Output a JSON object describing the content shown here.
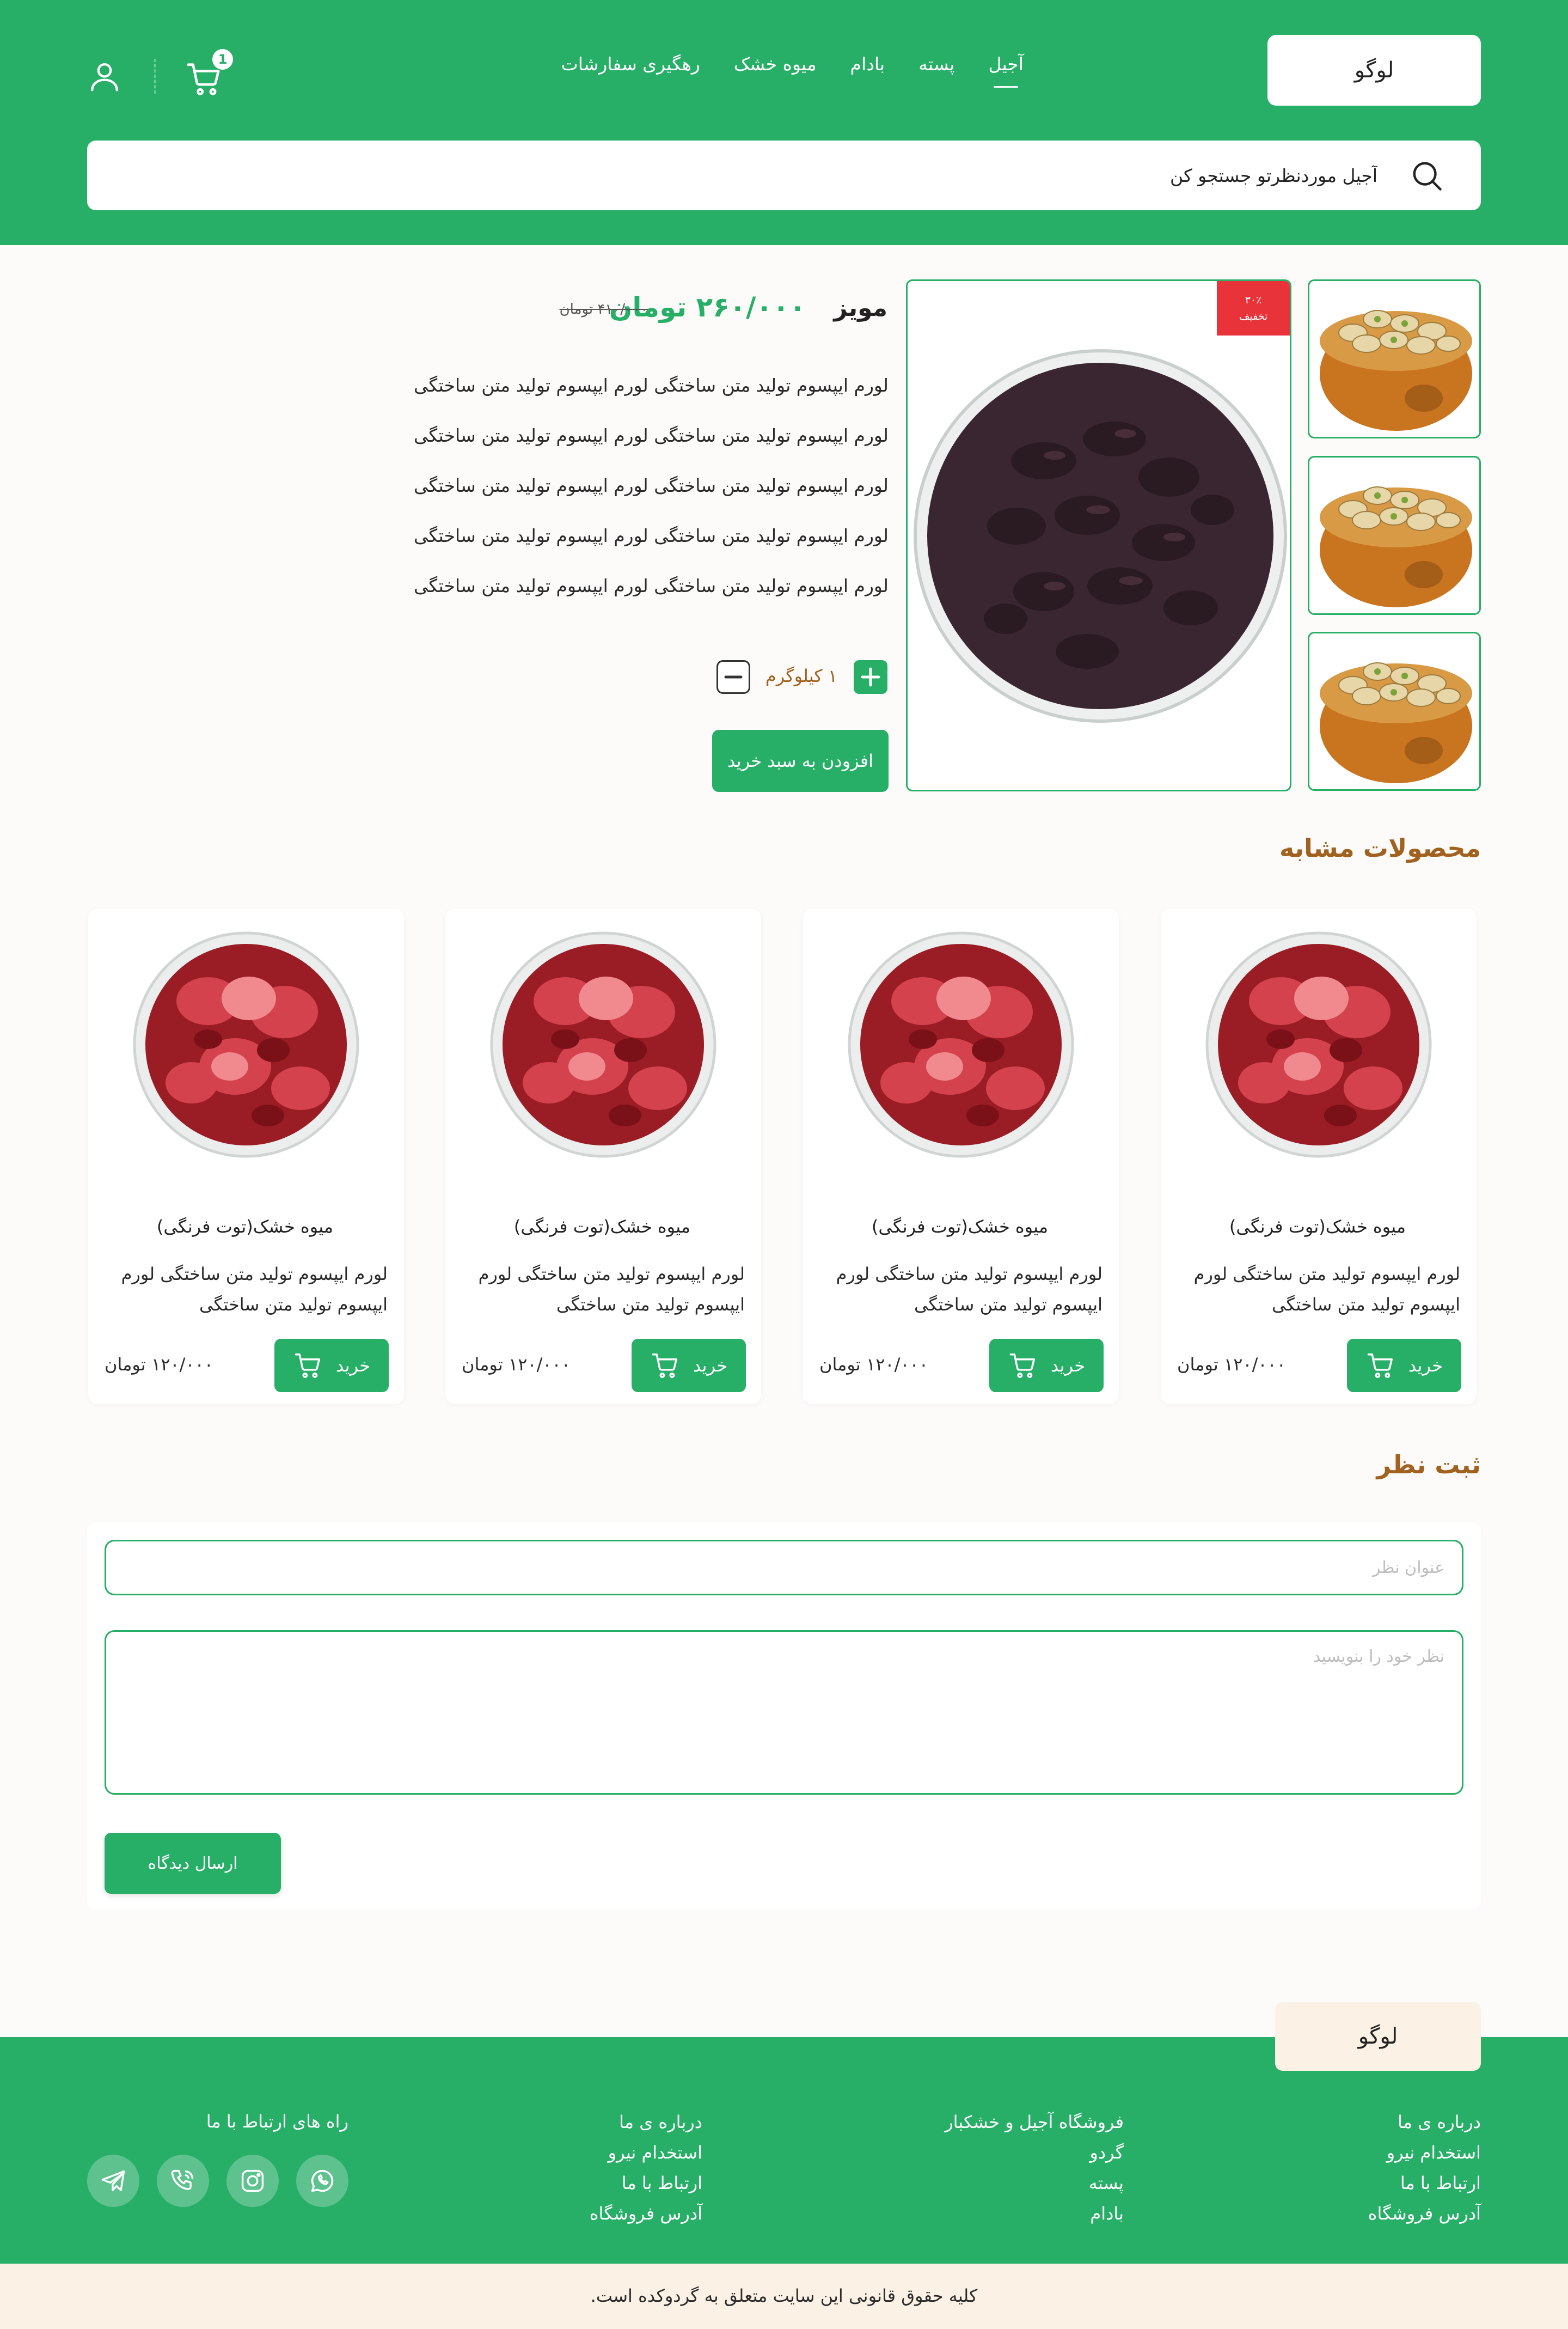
{
  "header": {
    "logo": "لوگو",
    "nav": [
      "آجیل",
      "پسته",
      "بادام",
      "میوه خشک",
      "رهگیری سفارشات"
    ],
    "active_nav": "آجیل",
    "cart_count": "1",
    "search_placeholder": "آجیل موردنظرتو جستجو کن"
  },
  "product": {
    "name": "مویز",
    "price": "۲۶۰/۰۰۰ تومان",
    "old_price": "۴۱۰/۰۰۰ تومان",
    "discount_percent": "۳۰٪",
    "discount_label": "تخفیف",
    "description_lines": [
      "لورم ایپسوم تولید متن ساختگی لورم ایپسوم تولید متن ساختگی",
      "لورم ایپسوم تولید متن ساختگی لورم ایپسوم تولید متن ساختگی",
      "لورم ایپسوم تولید متن ساختگی لورم ایپسوم تولید متن ساختگی",
      "لورم ایپسوم تولید متن ساختگی لورم ایپسوم تولید متن ساختگی",
      "لورم ایپسوم تولید متن ساختگی لورم ایپسوم تولید متن ساختگی"
    ],
    "quantity": "۱ کیلوگرم",
    "add_to_cart": "افزودن به سبد خرید"
  },
  "similar": {
    "title": "محصولات مشابه",
    "products": [
      {
        "name": "میوه خشک(توت فرنگی)",
        "description": "لورم ایپسوم تولید متن ساختگی لورم ایپسوم تولید متن ساختگی",
        "buy_label": "خرید",
        "price": "۱۲۰/۰۰۰ تومان"
      },
      {
        "name": "میوه خشک(توت فرنگی)",
        "description": "لورم ایپسوم تولید متن ساختگی لورم ایپسوم تولید متن ساختگی",
        "buy_label": "خرید",
        "price": "۱۲۰/۰۰۰ تومان"
      },
      {
        "name": "میوه خشک(توت فرنگی)",
        "description": "لورم ایپسوم تولید متن ساختگی لورم ایپسوم تولید متن ساختگی",
        "buy_label": "خرید",
        "price": "۱۲۰/۰۰۰ تومان"
      },
      {
        "name": "میوه خشک(توت فرنگی)",
        "description": "لورم ایپسوم تولید متن ساختگی لورم ایپسوم تولید متن ساختگی",
        "buy_label": "خرید",
        "price": "۱۲۰/۰۰۰ تومان"
      }
    ]
  },
  "comment": {
    "title": "ثبت نظر",
    "title_placeholder": "عنوان نظر",
    "body_placeholder": "نظر خود را بنویسید",
    "submit": "ارسال دیدگاه"
  },
  "footer": {
    "logo": "لوگو",
    "col1": [
      "درباره ی ما",
      "استخدام نیرو",
      "ارتباط با ما",
      "آدرس فروشگاه"
    ],
    "col2": [
      "فروشگاه آجیل و خشکبار",
      "گردو",
      "پسته",
      "بادام"
    ],
    "col3": [
      "درباره ی ما",
      "استخدام نیرو",
      "ارتباط با ما",
      "آدرس فروشگاه"
    ],
    "contact_heading": "راه های ارتباط با ما",
    "social": [
      "whatsapp-icon",
      "instagram-icon",
      "phone-icon",
      "telegram-icon"
    ],
    "copyright": "کلیه حقوق قانونی این سایت متعلق به گردوکده است."
  },
  "colors": {
    "primary": "#27ae67",
    "accent_brown": "#a1621f",
    "discount_red": "#e8333a",
    "cream": "#fcf1e5"
  }
}
